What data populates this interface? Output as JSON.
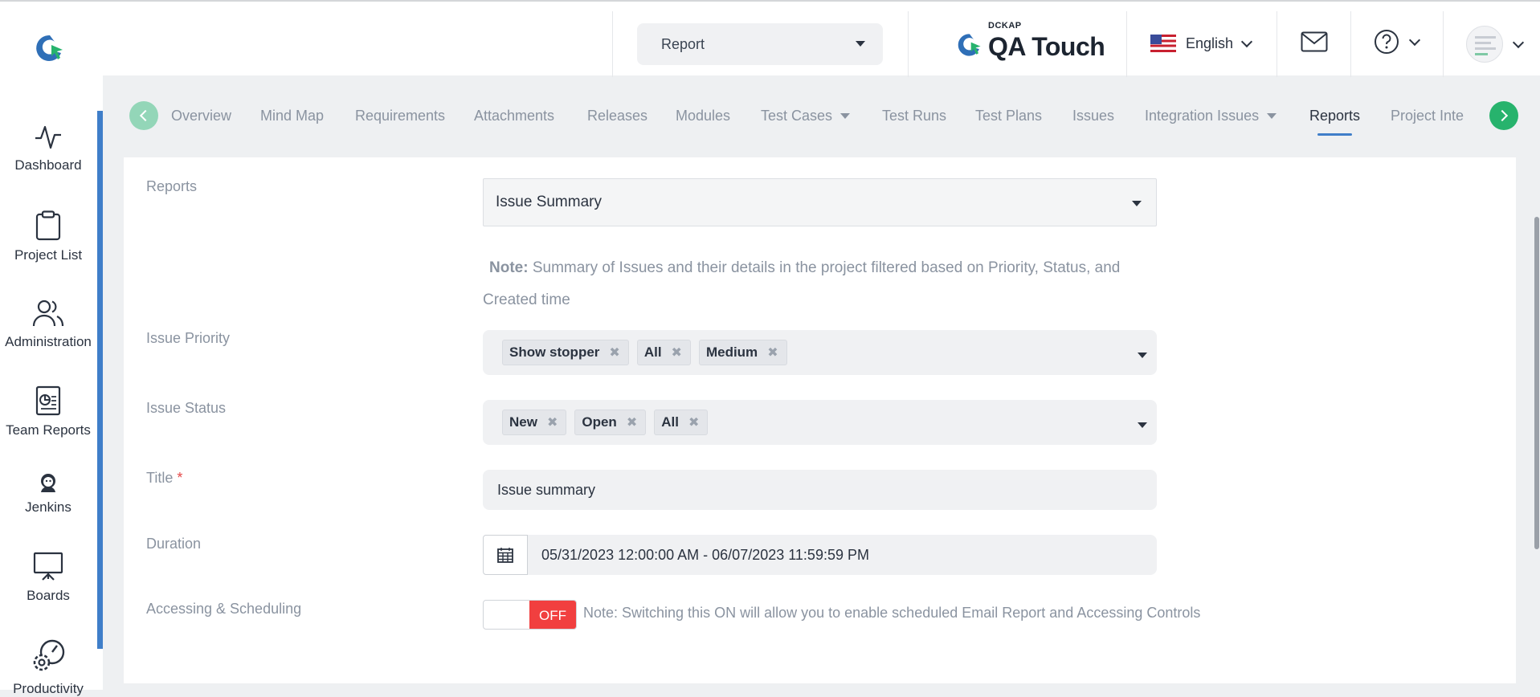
{
  "header": {
    "report_dropdown": "Report",
    "brand_small": "DCKAP",
    "brand_name": "QA Touch",
    "language": "English"
  },
  "sidebar": {
    "items": [
      {
        "label": "Dashboard",
        "icon": "activity-icon"
      },
      {
        "label": "Project List",
        "icon": "clipboard-icon"
      },
      {
        "label": "Administration",
        "icon": "users-icon"
      },
      {
        "label": "Team Reports",
        "icon": "report-icon"
      },
      {
        "label": "Jenkins",
        "icon": "jenkins-icon"
      },
      {
        "label": "Boards",
        "icon": "presentation-board-icon"
      },
      {
        "label": "Productivity",
        "icon": "gauge-gear-icon"
      }
    ]
  },
  "tabs": [
    {
      "label": "Overview"
    },
    {
      "label": "Mind Map"
    },
    {
      "label": "Requirements"
    },
    {
      "label": "Attachments"
    },
    {
      "label": "Releases"
    },
    {
      "label": "Modules"
    },
    {
      "label": "Test Cases"
    },
    {
      "label": "Test Runs"
    },
    {
      "label": "Test Plans"
    },
    {
      "label": "Issues"
    },
    {
      "label": "Integration Issues"
    },
    {
      "label": "Reports"
    },
    {
      "label": "Project Inte"
    }
  ],
  "form": {
    "reports_label": "Reports",
    "reports_value": "Issue Summary",
    "note_label": "Note:",
    "note_text": "Summary of Issues and their details in the project filtered based on Priority, Status, and Created time",
    "priority_label": "Issue Priority",
    "priority_chips": [
      "Show stopper",
      "All",
      "Medium"
    ],
    "status_label": "Issue Status",
    "status_chips": [
      "New",
      "Open",
      "All"
    ],
    "title_label": "Title",
    "title_required": "*",
    "title_value": "Issue summary",
    "duration_label": "Duration",
    "duration_value": "05/31/2023 12:00:00 AM - 06/07/2023 11:59:59 PM",
    "scheduling_label": "Accessing & Scheduling",
    "toggle_state": "OFF",
    "scheduling_note": "Note: Switching this ON will allow you to enable scheduled Email Report and Accessing Controls"
  },
  "colors": {
    "accent_blue": "#3f7ec9",
    "nav_green": "#27b36d",
    "toggle_off_red": "#f13f3f"
  }
}
